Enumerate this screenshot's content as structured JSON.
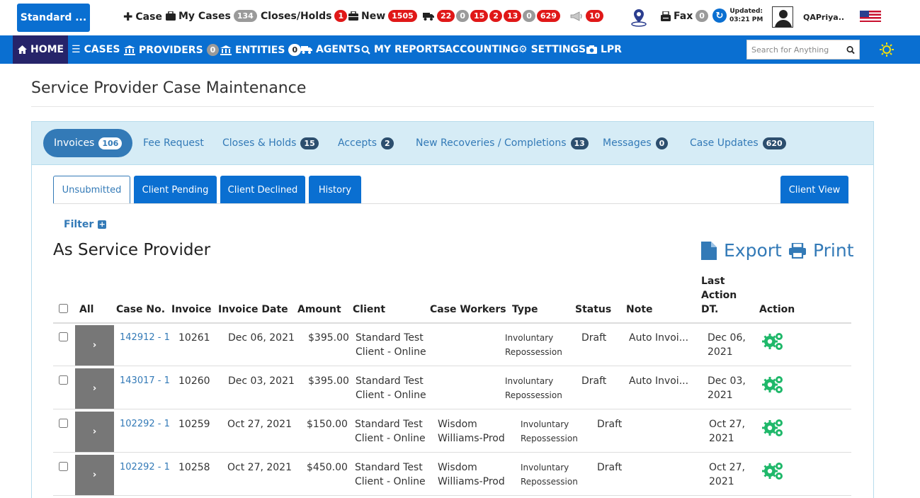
{
  "topbar": {
    "brand": "Standard ...",
    "new_case": "Case",
    "my_cases": {
      "label": "My Cases",
      "count": "134"
    },
    "closes_holds": {
      "label": "Closes/Holds",
      "count": "1"
    },
    "new": {
      "label": "New",
      "count": "1505"
    },
    "truck_counts": [
      "22",
      "0",
      "15",
      "2",
      "13",
      "0",
      "629"
    ],
    "announce_count": "10",
    "fax": {
      "label": "Fax",
      "count": "0"
    },
    "updated": {
      "label": "Updated:",
      "time": "03:21 PM"
    },
    "username": "QAPriya.."
  },
  "nav": {
    "home": "HOME",
    "cases": "CASES",
    "providers": {
      "label": "PROVIDERS",
      "count": "0"
    },
    "entities": {
      "label": "ENTITIES",
      "count": "0"
    },
    "agents": "AGENTS",
    "my_reports": "MY REPORTS",
    "accounting": "ACCOUNTING",
    "settings": "SETTINGS",
    "lpr": "LPR",
    "search_placeholder": "Search for Anything"
  },
  "page_title": "Service Provider Case Maintenance",
  "panel_tabs": [
    {
      "label": "Invoices",
      "count": "106"
    },
    {
      "label": "Fee Request",
      "count": ""
    },
    {
      "label": "Closes & Holds",
      "count": "15"
    },
    {
      "label": "Accepts",
      "count": "2"
    },
    {
      "label": "New Recoveries / Completions",
      "count": "13"
    },
    {
      "label": "Messages",
      "count": "0"
    },
    {
      "label": "Case Updates",
      "count": "620"
    }
  ],
  "sub_tabs": {
    "unsubmitted": "Unsubmitted",
    "client_pending": "Client Pending",
    "client_declined": "Client Declined",
    "history": "History",
    "client_view": "Client View"
  },
  "filter_label": "Filter",
  "section_heading": "As Service Provider",
  "export_label": "Export",
  "print_label": "Print",
  "table": {
    "headers": {
      "all": "All",
      "case_no": "Case No.",
      "invoice": "Invoice",
      "invoice_date": "Invoice Date",
      "amount": "Amount",
      "client": "Client",
      "case_workers": "Case Workers",
      "type": "Type",
      "status": "Status",
      "note": "Note",
      "last_action_1": "Last",
      "last_action_2": "Action",
      "last_action_3": "DT.",
      "action": "Action"
    },
    "rows": [
      {
        "expander": "›",
        "case_no": "142912 - 1",
        "invoice": "10261",
        "date": "Dec 06, 2021",
        "amount": "$395.00",
        "client_1": "Standard Test",
        "client_2": "Client - Online",
        "worker_1": "",
        "worker_2": "",
        "type_1": "Involuntary",
        "type_2": "Repossession",
        "status": "Draft",
        "note": "Auto Invoi...",
        "last_1": "Dec 06,",
        "last_2": "2021"
      },
      {
        "expander": "›",
        "case_no": "143017 - 1",
        "invoice": "10260",
        "date": "Dec 03, 2021",
        "amount": "$395.00",
        "client_1": "Standard Test",
        "client_2": "Client - Online",
        "worker_1": "",
        "worker_2": "",
        "type_1": "Involuntary",
        "type_2": "Repossession",
        "status": "Draft",
        "note": "Auto Invoi...",
        "last_1": "Dec 03,",
        "last_2": "2021"
      },
      {
        "expander": "›",
        "case_no": "102292 - 1",
        "invoice": "10259",
        "date": "Oct 27, 2021",
        "amount": "$150.00",
        "client_1": "Standard Test",
        "client_2": "Client - Online",
        "worker_1": "Wisdom",
        "worker_2": "Williams-Prod",
        "type_1": "Involuntary",
        "type_2": "Repossession",
        "status": "Draft",
        "note": "",
        "last_1": "Oct 27,",
        "last_2": "2021"
      },
      {
        "expander": "›",
        "case_no": "102292 - 1",
        "invoice": "10258",
        "date": "Oct 27, 2021",
        "amount": "$450.00",
        "client_1": "Standard Test",
        "client_2": "Client - Online",
        "worker_1": "Wisdom",
        "worker_2": "Williams-Prod",
        "type_1": "Involuntary",
        "type_2": "Repossession",
        "status": "Draft",
        "note": "",
        "last_1": "Oct 27,",
        "last_2": "2021"
      }
    ]
  },
  "colors": {
    "primary": "#0a6fd1",
    "nav_home_bg": "#26246a",
    "badge_red": "#e01818",
    "badge_gray": "#9a9a9a",
    "link": "#337ab7",
    "gear_green": "#1fb86a"
  }
}
